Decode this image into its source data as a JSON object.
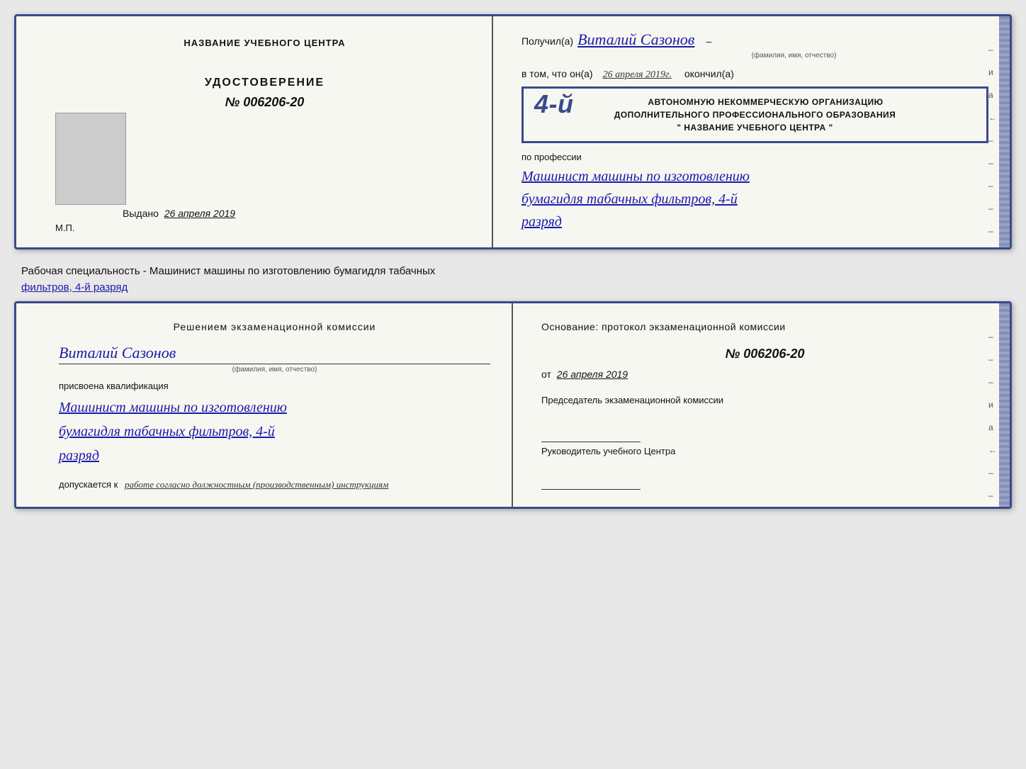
{
  "top_diploma": {
    "left": {
      "center_title": "НАЗВАНИЕ УЧЕБНОГО ЦЕНТРА",
      "udostoverenie_label": "УДОСТОВЕРЕНИЕ",
      "udostoverenie_number": "№ 006206-20",
      "vydano_label": "Выдано",
      "vydano_date": "26 апреля 2019",
      "mp_label": "М.П."
    },
    "right": {
      "poluchil_label": "Получил(а)",
      "recipient_name": "Виталий Сазонов",
      "fio_label": "(фамилия, имя, отчество)",
      "vtom_label": "в том, что он(а)",
      "date_label": "26 апреля 2019г.",
      "okonchil_label": "окончил(а)",
      "stamp_line1": "АВТОНОМНУЮ НЕКОММЕРЧЕСКУЮ ОРГАНИЗАЦИЮ",
      "stamp_line2": "ДОПОЛНИТЕЛЬНОГО ПРОФЕССИОНАЛЬНОГО ОБРАЗОВАНИЯ",
      "stamp_line3": "\" НАЗВАНИЕ УЧЕБНОГО ЦЕНТРА \"",
      "stamp_number": "4-й",
      "po_professii_label": "по профессии",
      "profession_line1": "Машинист машины по изготовлению",
      "profession_line2": "бумагидля табачных фильтров, 4-й",
      "profession_line3": "разряд",
      "marks": [
        "–",
        "и",
        "а",
        "←",
        "–",
        "–",
        "–",
        "–",
        "–"
      ]
    }
  },
  "specialty_text": {
    "prefix": "Рабочая специальность - Машинист машины по изготовлению бумагидля табачных",
    "underlined": "фильтров, 4-й разряд"
  },
  "bottom_diploma": {
    "left": {
      "decision_title": "Решением экзаменационной комиссии",
      "name": "Виталий Сазонов",
      "fio_label": "(фамилия, имя, отчество)",
      "присвоена_label": "присвоена квалификация",
      "profession_line1": "Машинист машины по изготовлению",
      "profession_line2": "бумагидля табачных фильтров, 4-й",
      "profession_line3": "разряд",
      "допускается_label": "допускается к",
      "допускается_val": "работе согласно должностным (производственным) инструкциям"
    },
    "right": {
      "osnov_label": "Основание: протокол экзаменационной комиссии",
      "protocol_number": "№ 006206-20",
      "ot_label": "от",
      "ot_date": "26 апреля 2019",
      "chairman_label": "Председатель экзаменационной комиссии",
      "rukov_label": "Руководитель учебного Центра",
      "marks": [
        "–",
        "–",
        "–",
        "и",
        "а",
        "←",
        "–",
        "–",
        "–",
        "–"
      ]
    }
  }
}
